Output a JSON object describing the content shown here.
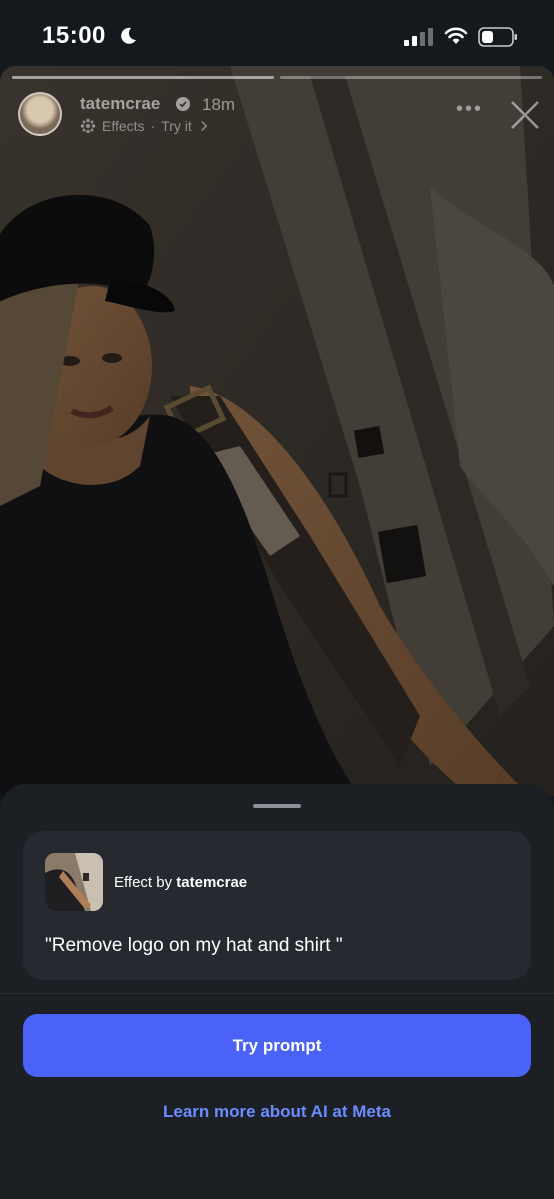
{
  "status_bar": {
    "time": "15:00",
    "icons": [
      "moon-icon",
      "cellular-signal-icon",
      "wifi-icon",
      "battery-icon"
    ]
  },
  "story": {
    "username": "tatemcrae",
    "verified": true,
    "time_ago": "18m",
    "effects_label": "Effects",
    "separator": "·",
    "try_it_label": "Try it",
    "progress_segments": 2,
    "progress_active_index": 0,
    "icons": [
      "more-icon",
      "close-icon",
      "effects-icon",
      "chevron-right-icon",
      "verified-badge-icon"
    ]
  },
  "sheet": {
    "effect_by_prefix": "Effect by",
    "effect_by_user": "tatemcrae",
    "prompt_text": "\"Remove logo on my hat and shirt \"",
    "try_button_label": "Try prompt",
    "learn_more_label": "Learn more about AI at Meta"
  },
  "colors": {
    "background": "#15181d",
    "sheet": "#1c1f24",
    "card": "#262a30",
    "accent_button": "#4a62f7",
    "link": "#6b8cff"
  }
}
